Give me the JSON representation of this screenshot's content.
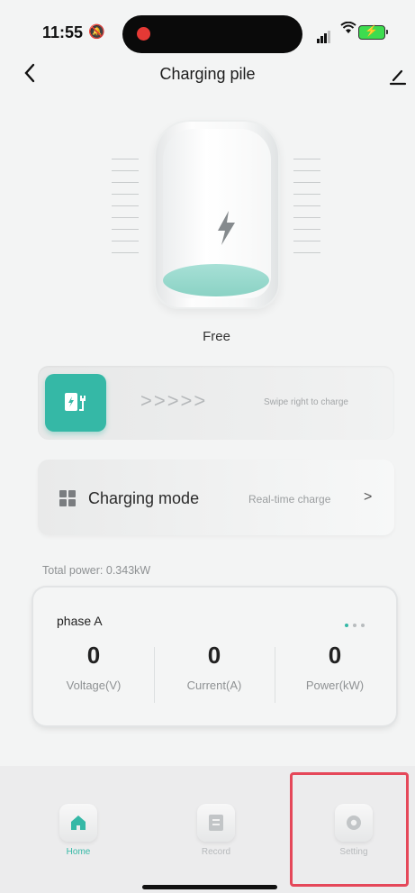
{
  "status_bar": {
    "time": "11:55"
  },
  "header": {
    "title": "Charging pile"
  },
  "charger": {
    "state": "Free"
  },
  "swipe": {
    "arrows": ">>>>>",
    "hint": "Swipe right to charge"
  },
  "charging_mode": {
    "label": "Charging mode",
    "value": "Real-time charge",
    "chevron": ">"
  },
  "total_power": "Total power:  0.343kW",
  "phase": {
    "title": "phase A",
    "metrics": [
      {
        "value": "0",
        "label": "Voltage(V)"
      },
      {
        "value": "0",
        "label": "Current(A)"
      },
      {
        "value": "0",
        "label": "Power(kW)"
      }
    ]
  },
  "tabs": [
    {
      "label": "Home",
      "icon": "home-icon",
      "active": true
    },
    {
      "label": "Record",
      "icon": "record-icon",
      "active": false
    },
    {
      "label": "Setting",
      "icon": "setting-icon",
      "active": false
    }
  ],
  "colors": {
    "accent": "#35b8a6",
    "highlight": "#e5485a"
  }
}
